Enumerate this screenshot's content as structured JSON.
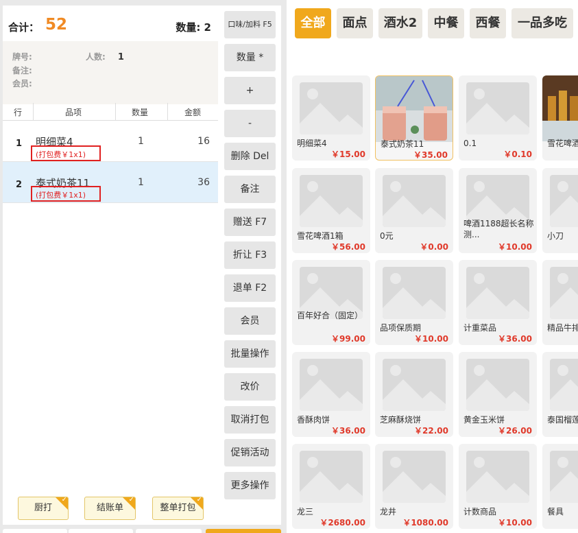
{
  "order": {
    "total_label": "合计：",
    "total_value": "52",
    "qty_label": "数量:  2",
    "info": {
      "table_no_label": "牌号:",
      "guests_label": "人数:",
      "guests_value": "1",
      "remark_label": "备注:",
      "member_label": "会员:"
    },
    "columns": [
      "行",
      "品项",
      "数量",
      "金额"
    ],
    "rows": [
      {
        "no": "1",
        "name": "明细菜4",
        "qty": "1",
        "amount": "16",
        "fee": "(打包费￥1x1)"
      },
      {
        "no": "2",
        "name": "泰式奶茶11",
        "qty": "1",
        "amount": "36",
        "fee": "(打包费￥1x1)"
      }
    ],
    "bottom_buttons": [
      "厨打",
      "结账单",
      "整单打包"
    ],
    "check_mark": "✓"
  },
  "actions": [
    "口味/加料 F5",
    "数量 *",
    "+",
    "-",
    "删除 Del",
    "备注",
    "赠送 F7",
    "折让 F3",
    "退单 F2",
    "会员",
    "批量操作",
    "改价",
    "取消打包",
    "促销活动",
    "更多操作"
  ],
  "categories": [
    "全部",
    "面点",
    "酒水2",
    "中餐",
    "西餐",
    "一品多吃"
  ],
  "active_category": "全部",
  "products": [
    {
      "name": "明细菜4",
      "price": "￥15.00"
    },
    {
      "name": "泰式奶茶11",
      "price": "￥35.00"
    },
    {
      "name": "0.1",
      "price": "￥0.10"
    },
    {
      "name": "雪花啤酒",
      "price": ""
    },
    {
      "name": "雪花啤酒1箱",
      "price": "￥56.00"
    },
    {
      "name": "0元",
      "price": "￥0.00"
    },
    {
      "name": "啤酒1188超长名称测...",
      "price": "￥10.00"
    },
    {
      "name": "小刀",
      "price": ""
    },
    {
      "name": "百年好合（固定）",
      "price": "￥99.00"
    },
    {
      "name": "品项保质期",
      "price": "￥10.00"
    },
    {
      "name": "计重菜品",
      "price": "￥36.00"
    },
    {
      "name": "精品牛排",
      "price": ""
    },
    {
      "name": "香酥肉饼",
      "price": "￥36.00"
    },
    {
      "name": "芝麻酥烧饼",
      "price": "￥22.00"
    },
    {
      "name": "黄金玉米饼",
      "price": "￥26.00"
    },
    {
      "name": "泰国榴莲",
      "price": ""
    },
    {
      "name": "龙三",
      "price": "￥2680.00"
    },
    {
      "name": "龙井",
      "price": "￥1080.00"
    },
    {
      "name": "计数商品",
      "price": "￥10.00"
    },
    {
      "name": "餐具",
      "price": ""
    }
  ]
}
